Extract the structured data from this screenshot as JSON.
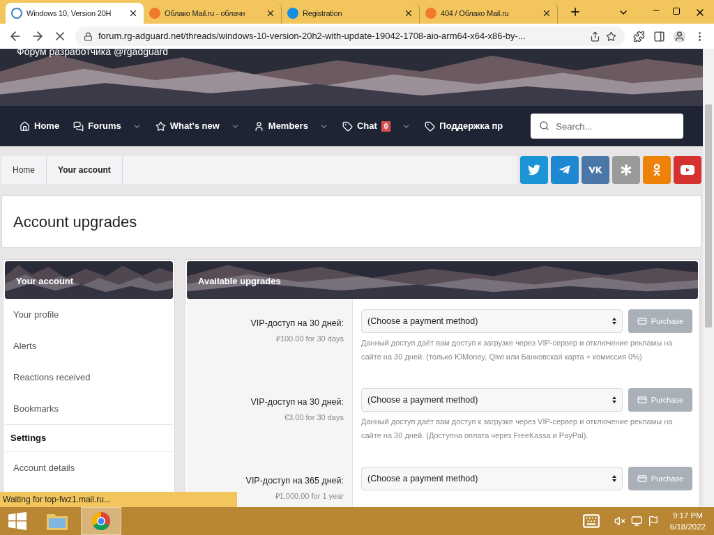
{
  "browser": {
    "tabs": [
      {
        "title": "Windows 10, Version 20H",
        "selected": true
      },
      {
        "title": "Облако Mail.ru - облачн",
        "selected": false
      },
      {
        "title": "Registration",
        "selected": false
      },
      {
        "title": "404 / Облако Mail.ru",
        "selected": false
      }
    ],
    "url": "forum.rg-adguard.net/threads/windows-10-version-20h2-with-update-19042-1708-aio-arm64-x64-x86-by-..."
  },
  "banner": {
    "subtitle": "Форум разработчика @rgadguard"
  },
  "nav": {
    "items": [
      {
        "label": "Home",
        "dropdown": false
      },
      {
        "label": "Forums",
        "dropdown": true
      },
      {
        "label": "What's new",
        "dropdown": true
      },
      {
        "label": "Members",
        "dropdown": true
      },
      {
        "label": "Chat",
        "dropdown": true,
        "badge": "0"
      },
      {
        "label": "Поддержка пр",
        "dropdown": false
      }
    ],
    "search": {
      "placeholder": "Search..."
    }
  },
  "breadcrumb": [
    "Home",
    "Your account"
  ],
  "social": [
    {
      "color": "#1b95d6"
    },
    {
      "color": "#1e88d3"
    },
    {
      "color": "#4a76a8"
    },
    {
      "color": "#9a9a9a"
    },
    {
      "color": "#ee8208"
    },
    {
      "color": "#d53131"
    }
  ],
  "page_title": "Account upgrades",
  "sidebar": {
    "title": "Your account",
    "items": [
      {
        "kind": "link",
        "label": "Your profile"
      },
      {
        "kind": "link",
        "label": "Alerts"
      },
      {
        "kind": "link",
        "label": "Reactions received"
      },
      {
        "kind": "link",
        "label": "Bookmarks"
      },
      {
        "kind": "heading",
        "label": "Settings"
      },
      {
        "kind": "link",
        "label": "Account details"
      }
    ]
  },
  "upgrades": {
    "title": "Available upgrades",
    "rows": [
      {
        "name": "VIP-доступ на 30 дней:",
        "price": "₽100.00 for 30 days",
        "payment": "(Choose a payment method)",
        "button": "Purchase",
        "disabled": true,
        "description": "Данный доступ даёт вам доступ к загрузке через VIP-сервер и отключение рекламы на сайте на 30 дней. (только ЮMoney, Qiwi или Банковская карта + комиссия 0%)"
      },
      {
        "name": "VIP-доступ на 30 дней:",
        "price": "€3.00 for 30 days",
        "payment": "(Choose a payment method)",
        "button": "Purchase",
        "disabled": true,
        "description": "Данный доступ даёт вам доступ к загрузке через VIP-сервер и отключение рекламы на сайте на 30 дней. (Доступна оплата через FreeKassa и PayPal)."
      },
      {
        "name": "VIP-доступ на 365 дней:",
        "price": "₽1,000.00 for 1 year",
        "payment": "(Choose a payment method)",
        "button": "Purchase",
        "disabled": true
      }
    ]
  },
  "status": "Waiting for top-fwz1.mail.ru...",
  "taskbar": {
    "time": "9:17 PM",
    "date": "6/18/2022"
  }
}
